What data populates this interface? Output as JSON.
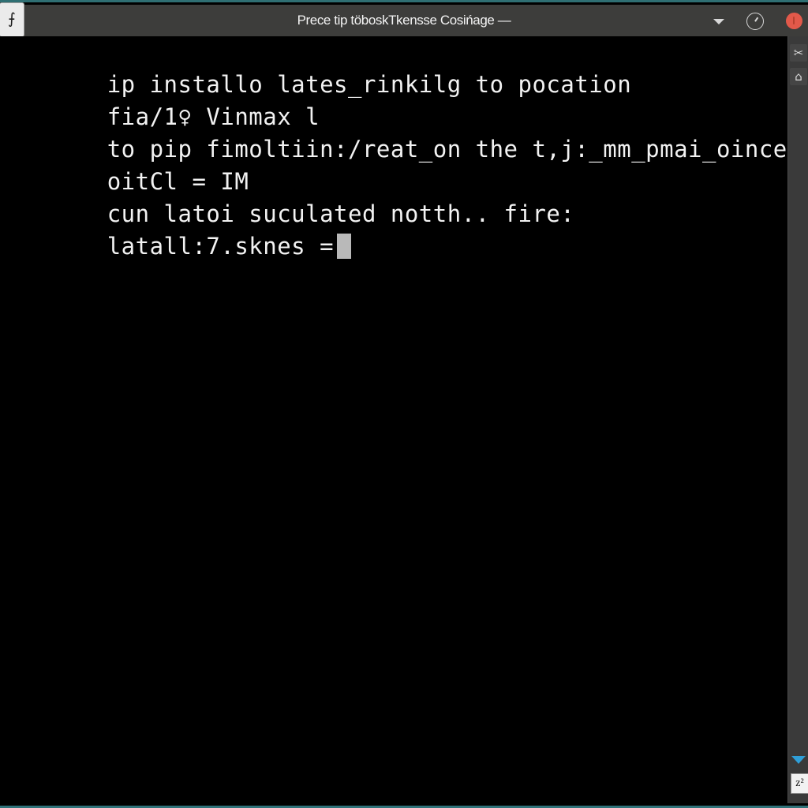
{
  "window": {
    "title": "Prece tip töboskTkensse Cosińage —",
    "app_icon": "terminal-icon",
    "app_icon_glyph": "⨍",
    "controls": {
      "minimize": {
        "name": "minimize-button",
        "glyph": "chevron-down-icon"
      },
      "maximize": {
        "name": "maximize-button",
        "glyph": "clock-circle-icon"
      },
      "close": {
        "name": "close-button",
        "glyph": "close-dot-icon"
      }
    },
    "border_color": "#2f6f73",
    "titlebar_color": "#3d3d3b"
  },
  "terminal": {
    "background": "#000000",
    "foreground": "#f2f2f2",
    "cursor_color": "#b9b9b9",
    "lines": [
      "ip installo lates_rinkilg to pocation",
      "fia/1♀ Vinmax l",
      "to pip fimoltiin:/reat_on the t,j:_mm_pmai_oincet).",
      "oitCl = IM",
      "cun latoi suculated notth.. fire:",
      "latall:7.sknes ="
    ],
    "cursor_line_index": 5
  },
  "sidebar": {
    "background": "#3a3a3a",
    "top_buttons": [
      {
        "name": "cut-icon",
        "glyph": "✂"
      },
      {
        "name": "home-icon",
        "glyph": "⌂"
      }
    ],
    "bottom_buttons": [
      {
        "name": "scroll-down-icon",
        "glyph": "chevron-down",
        "color": "#2f9fd8"
      },
      {
        "name": "resize-icon",
        "glyph": "z²"
      }
    ]
  }
}
